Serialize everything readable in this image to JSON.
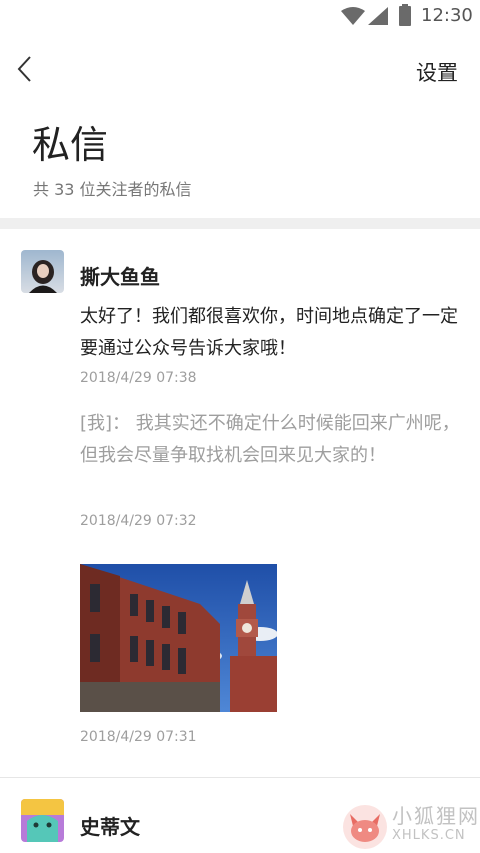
{
  "status_bar": {
    "time": "12:30",
    "icons": [
      "wifi-icon",
      "signal-icon",
      "battery-icon"
    ]
  },
  "header": {
    "back_icon": "chevron-left-icon",
    "settings_label": "设置"
  },
  "page": {
    "title": "私信",
    "subtitle": "共 33 位关注者的私信"
  },
  "threads": [
    {
      "name": "撕大鱼鱼",
      "messages": [
        {
          "from": "them",
          "text": "太好了！我们都很喜欢你，时间地点确定了一定要通过公众号告诉大家哦！",
          "time": "2018/4/29  07:38"
        },
        {
          "from": "me",
          "text": "[我]： 我其实还不确定什么时候能回来广州呢，但我会尽量争取找机会回来见大家的！",
          "time": "2018/4/29  07:32"
        },
        {
          "from": "them",
          "type": "image",
          "image_desc": "red-brick-clock-tower-photo",
          "time": "2018/4/29  07:31"
        }
      ]
    },
    {
      "name": "史蒂文"
    }
  ],
  "watermark": {
    "cn": "小狐狸网",
    "en": "XHLKS.CN"
  }
}
